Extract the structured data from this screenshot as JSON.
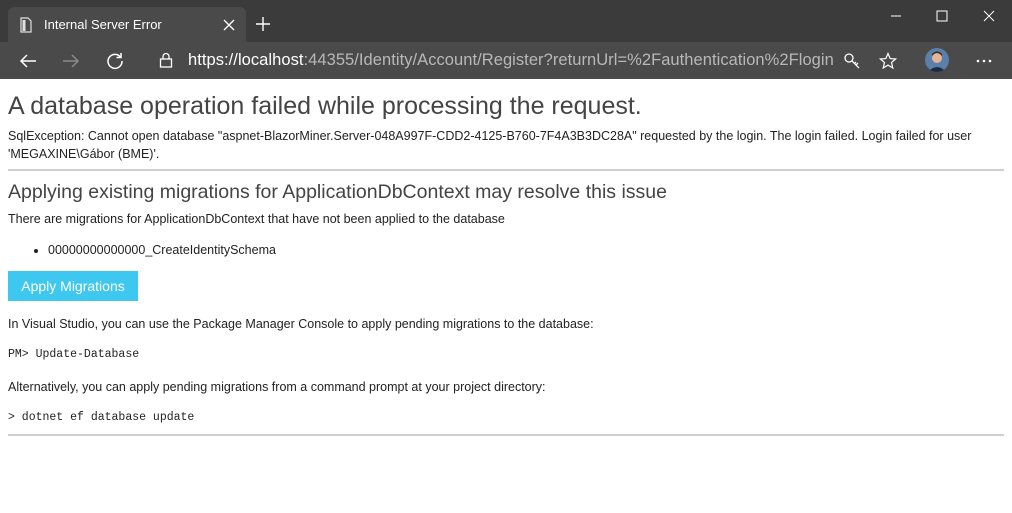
{
  "browser": {
    "tab": {
      "title": "Internal Server Error",
      "favicon": "page-icon",
      "close_icon": "close-icon"
    },
    "new_tab_icon": "plus-icon",
    "window_controls": [
      "minimize-icon",
      "maximize-icon",
      "close-icon"
    ],
    "toolbar": {
      "back_icon": "back-arrow-icon",
      "forward_icon": "forward-arrow-icon",
      "refresh_icon": "refresh-icon",
      "lock_icon": "lock-icon",
      "url_scheme": "https://",
      "url_host": "localhost",
      "url_rest": ":44355/Identity/Account/Register?returnUrl=%2Fauthentication%2Flogin",
      "key_icon": "key-icon",
      "favorite_icon": "star-icon",
      "profile_icon": "avatar",
      "menu_icon": "more-icon"
    },
    "colors": {
      "titlebar": "#3b3b3b",
      "toolbar": "#4a4a4a"
    }
  },
  "page": {
    "title": "A database operation failed while processing the request.",
    "exception": "SqlException: Cannot open database \"aspnet-BlazorMiner.Server-048A997F-CDD2-4125-B760-7F4A3B3DC28A\" requested by the login. The login failed. Login failed for user 'MEGAXINE\\Gábor (BME)'.",
    "migrations_heading": "Applying existing migrations for ApplicationDbContext may resolve this issue",
    "migrations_intro": "There are migrations for ApplicationDbContext that have not been applied to the database",
    "migrations": [
      "00000000000000_CreateIdentitySchema"
    ],
    "apply_button_label": "Apply Migrations",
    "vs_text": "In Visual Studio, you can use the Package Manager Console to apply pending migrations to the database:",
    "pm_command": "PM> Update-Database",
    "alt_text": "Alternatively, you can apply pending migrations from a command prompt at your project directory:",
    "cli_command": "> dotnet ef database update",
    "colors": {
      "button": "#3ec7ef",
      "separator": "#cfcfcf"
    }
  }
}
